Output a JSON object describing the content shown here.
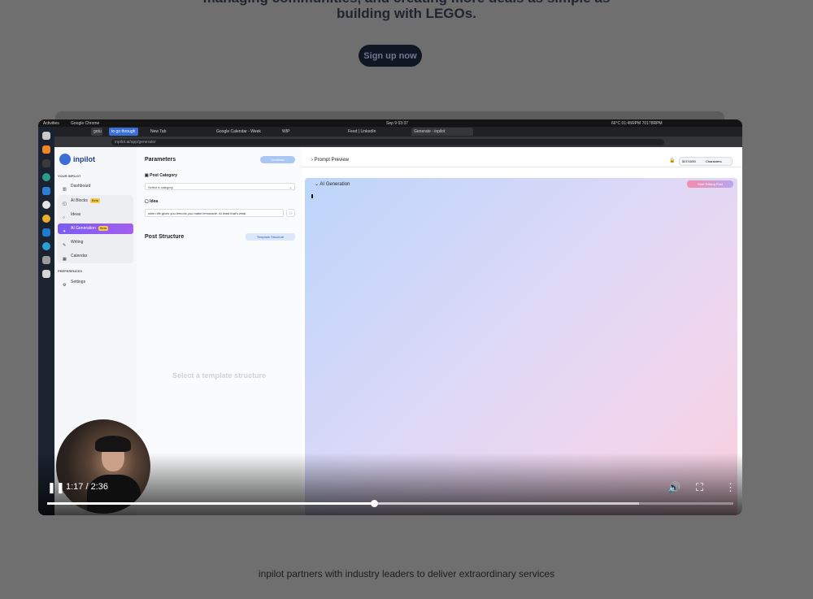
{
  "hero": {
    "line1": "managing communities, and creating more deals as simple as",
    "line2": "building with LEGOs.",
    "cta": "Sign up now"
  },
  "os": {
    "activities": "Activities",
    "app_name": "Google Chrome",
    "clock": "Sep 9  03:37",
    "weather": "66°C 01:45RPM 70178RPM"
  },
  "browser": {
    "tabs": [
      "New Tab",
      "Google Calendar - Week",
      "WIP",
      "Feed | LinkedIn",
      "Generate - inpilot"
    ],
    "pinned": [
      "gotu",
      "to go through"
    ],
    "url": "inpilot.ai/app/generator"
  },
  "app": {
    "brand": "inpilot",
    "section_your": "YOUR INPILOT",
    "section_prefs": "PREFERENCES",
    "nav": [
      {
        "label": "Dashboard",
        "icon": "chart-icon"
      },
      {
        "label": "AI Blocks",
        "badge": "Beta",
        "icon": "blocks-icon"
      },
      {
        "label": "Ideas",
        "icon": "bulb-icon"
      },
      {
        "label": "AI Generation",
        "badge": "Beta",
        "icon": "sparkle-icon"
      },
      {
        "label": "Writing",
        "icon": "pen-icon"
      },
      {
        "label": "Calendar",
        "icon": "calendar-icon"
      }
    ],
    "settings": "Settings",
    "params": {
      "title": "Parameters",
      "generate": "Generate",
      "post_category_label": "Post Category",
      "category_placeholder": "Select a category",
      "idea_label": "Idea",
      "idea_value": "when life gives you lemons you make lemonade. At least that's what",
      "post_structure": "Post Structure",
      "template_button": "Template Structure",
      "empty": "Select a template structure"
    },
    "right": {
      "prompt_preview": "Prompt Preview",
      "char_count": "507/1000",
      "char_label": "Characters",
      "ai_generation": "AI Generation",
      "start_editing": "Start Editing Post"
    }
  },
  "player": {
    "time": "1:17 / 2:36",
    "progress": 0.477,
    "buffered": 0.863
  },
  "footer": {
    "text": "inpilot partners with industry leaders to deliver extraordinary services"
  },
  "colors": {
    "accent": "#7a5cf0",
    "brand": "#3b6fd8",
    "page_bg": "#6f6f6f"
  }
}
